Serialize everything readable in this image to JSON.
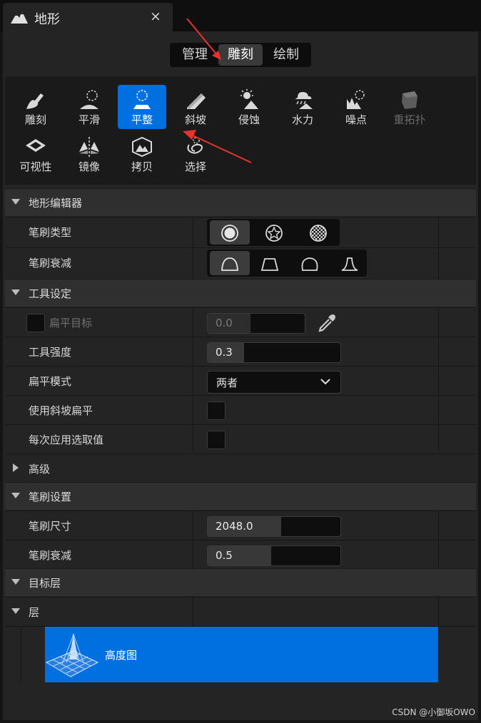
{
  "tab": {
    "title": "地形",
    "close": "×"
  },
  "modes": [
    "管理",
    "雕刻",
    "绘制"
  ],
  "tools": [
    "雕刻",
    "平滑",
    "平整",
    "斜坡",
    "侵蚀",
    "水力",
    "噪点",
    "重拓扑",
    "可视性",
    "镜像",
    "拷贝",
    "选择"
  ],
  "sections": {
    "editor": "地形编辑器",
    "tool_settings": "工具设定",
    "advanced": "高级",
    "brush_settings": "笔刷设置",
    "target_layers": "目标层",
    "layers": "层"
  },
  "editor": {
    "brush_type": "笔刷类型",
    "brush_falloff": "笔刷衰减"
  },
  "tool_settings": {
    "flatten_target_label": "扁平目标",
    "flatten_target_value": "0.0",
    "tool_strength_label": "工具强度",
    "tool_strength_value": "0.3",
    "flatten_mode_label": "扁平模式",
    "flatten_mode_value": "两者",
    "use_slope_flatten_label": "使用斜坡扁平",
    "pick_value_per_apply_label": "每次应用选取值"
  },
  "brush_settings": {
    "brush_size_label": "笔刷尺寸",
    "brush_size_value": "2048.0",
    "brush_falloff_label": "笔刷衰减",
    "brush_falloff_value": "0.5"
  },
  "layer": {
    "name": "高度图"
  },
  "watermark": "CSDN @小御坂OWO",
  "colors": {
    "accent": "#0070e0",
    "arrow": "#e8322e"
  }
}
